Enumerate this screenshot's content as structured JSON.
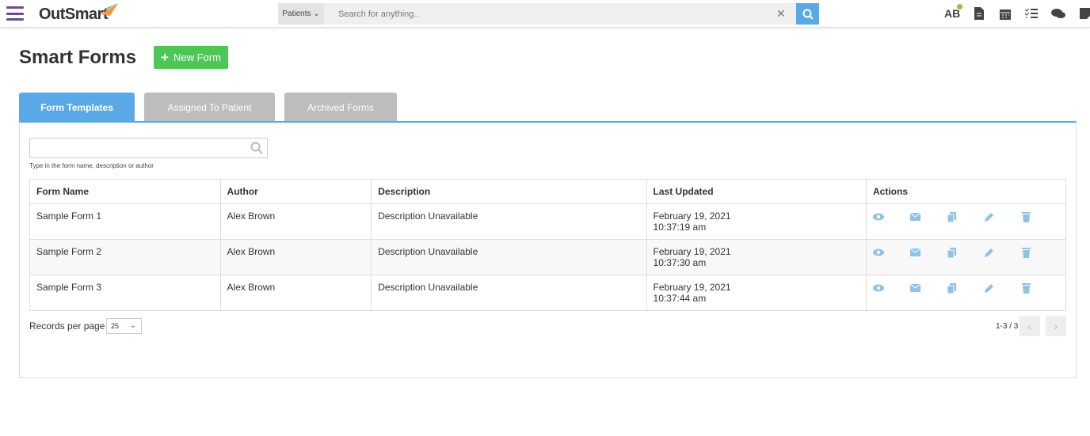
{
  "header": {
    "logo": "OutSmart",
    "search_scope": "Patients",
    "search_placeholder": "Search for anything..",
    "user_initials": "AB",
    "icons": [
      "document-icon",
      "calendar-icon",
      "checklist-icon",
      "chat-icon",
      "note-icon"
    ]
  },
  "page": {
    "title": "Smart Forms",
    "new_form_label": "New Form"
  },
  "tabs": [
    {
      "label": "Form Templates",
      "active": true
    },
    {
      "label": "Assigned To Patient"
    },
    {
      "label": "Archived Forms"
    }
  ],
  "filter": {
    "placeholder": "",
    "hint": "Type in the form name, description or author"
  },
  "table": {
    "columns": [
      "Form Name",
      "Author",
      "Description",
      "Last Updated",
      "Actions"
    ],
    "rows": [
      {
        "name": "Sample Form 1",
        "author": "Alex Brown",
        "description": "Description Unavailable",
        "date": "February 19, 2021",
        "time": "10:37:19 am"
      },
      {
        "name": "Sample Form 2",
        "author": "Alex Brown",
        "description": "Description Unavailable",
        "date": "February 19, 2021",
        "time": "10:37:30 am"
      },
      {
        "name": "Sample Form 3",
        "author": "Alex Brown",
        "description": "Description Unavailable",
        "date": "February 19, 2021",
        "time": "10:37:44 am"
      }
    ]
  },
  "pagination": {
    "records_label": "Records per page",
    "per_page": "25",
    "info": "1-3 / 3"
  },
  "colors": {
    "accent": "#5aa9e6",
    "new_button": "#4cc756",
    "tab_inactive": "#bdbdbd",
    "action_icon": "#8ec3e6",
    "brand_purple": "#6b4c8f"
  }
}
